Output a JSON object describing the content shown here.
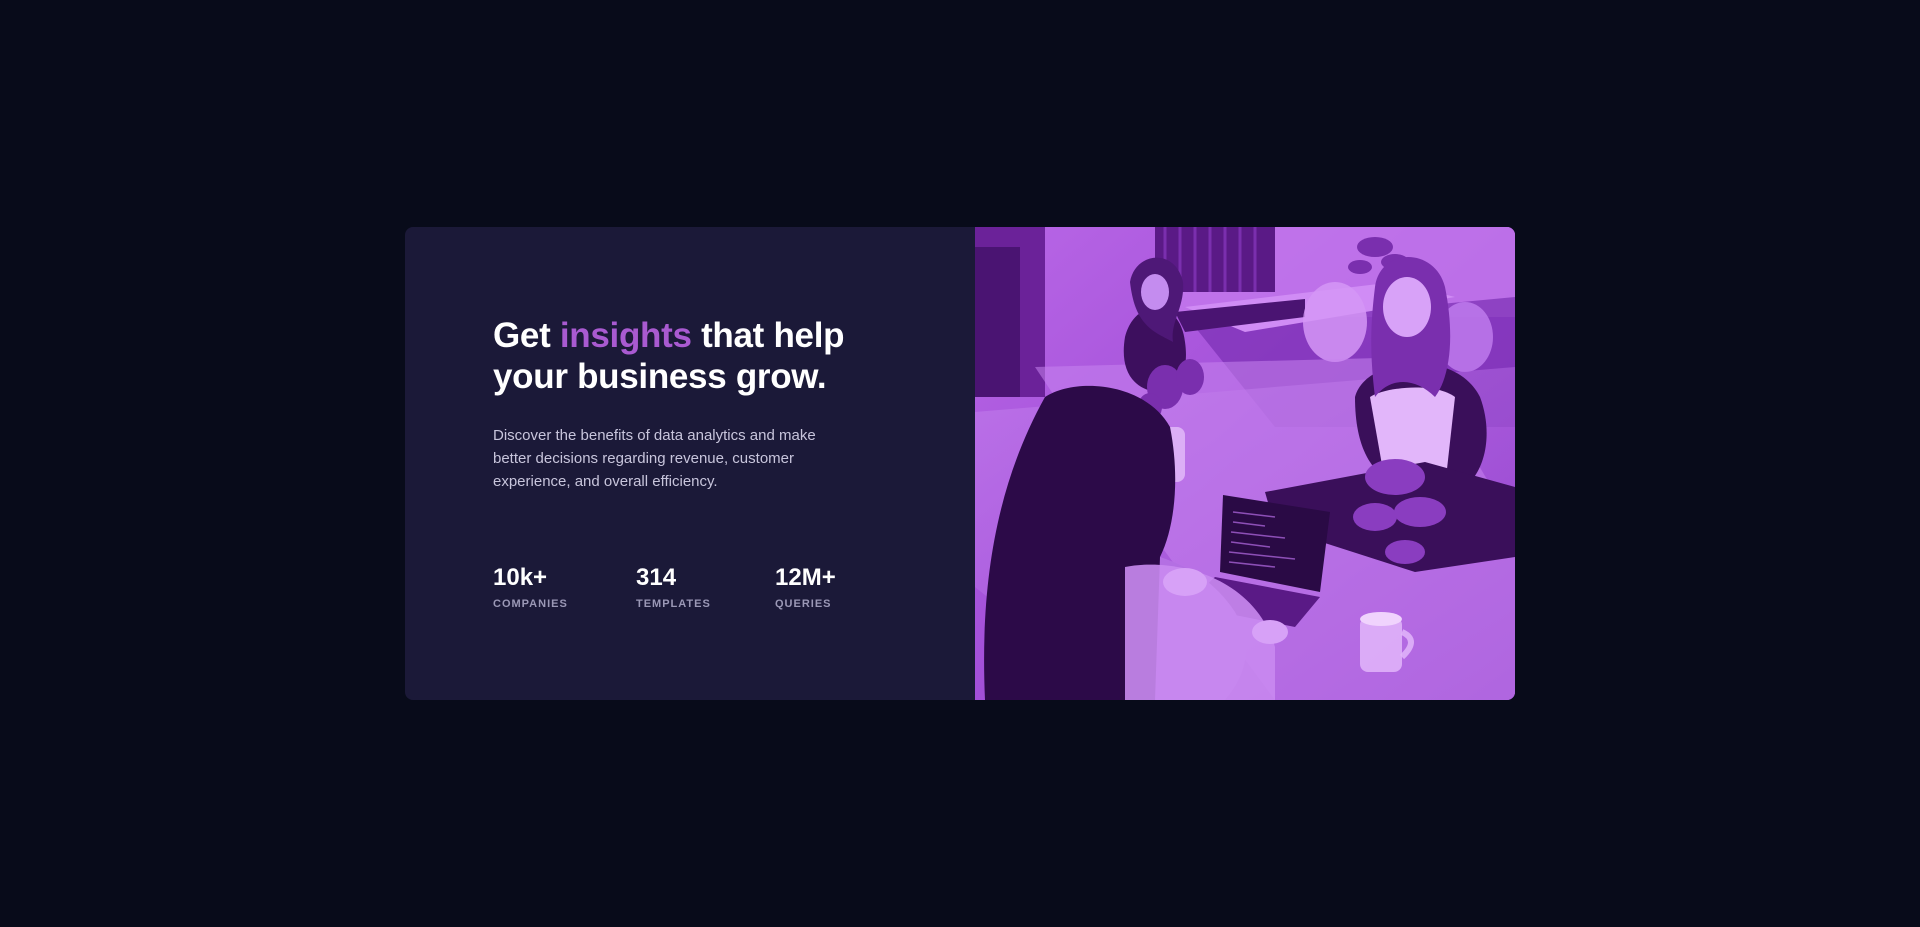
{
  "hero": {
    "headline_before": "Get ",
    "headline_accent": "insights",
    "headline_after": " that help your business grow.",
    "description": "Discover the benefits of data analytics and make better decisions regarding revenue, customer experience, and overall efficiency.",
    "stats": [
      {
        "value": "10k+",
        "label": "COMPANIES"
      },
      {
        "value": "314",
        "label": "TEMPLATES"
      },
      {
        "value": "12M+",
        "label": "QUERIES"
      }
    ]
  },
  "colors": {
    "page_background": "#080b1a",
    "card_background": "#1b1938",
    "accent": "#a95ad1",
    "heading": "#ffffff",
    "body_text": "#c8c5dc",
    "stat_label": "#9b98b6"
  }
}
